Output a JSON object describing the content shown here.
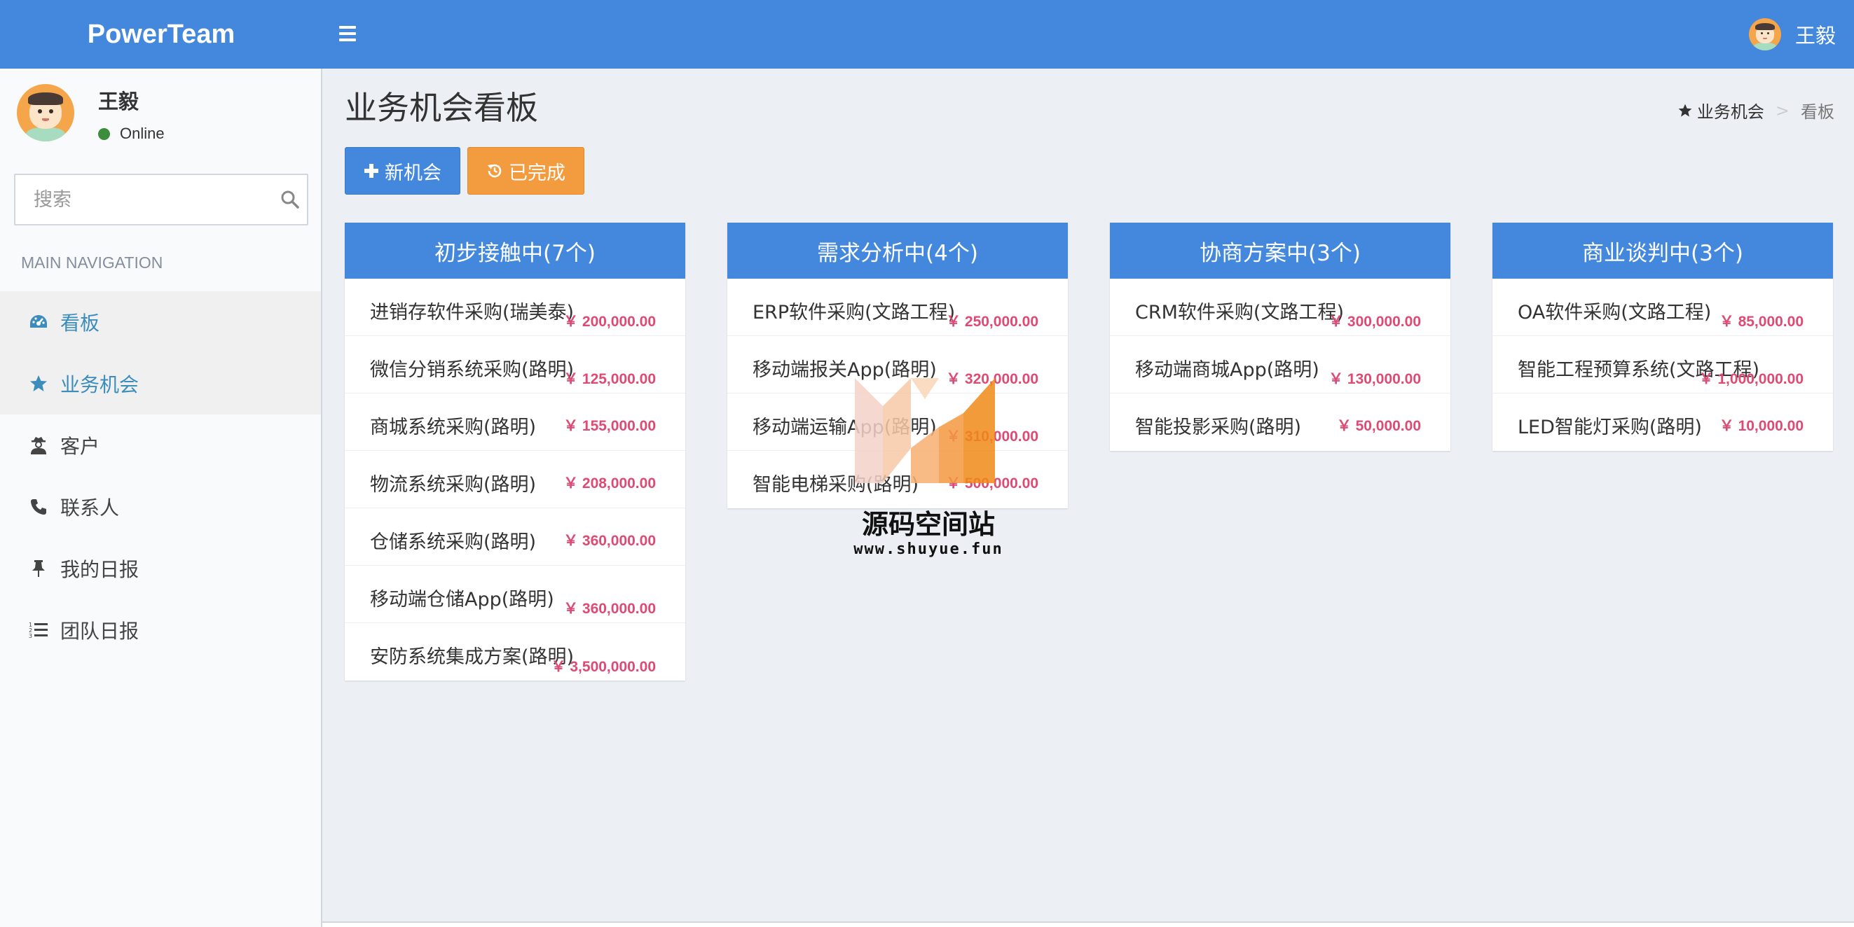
{
  "app": {
    "logo": "PowerTeam"
  },
  "header": {
    "user_name": "王毅"
  },
  "sidebar": {
    "user_name": "王毅",
    "status": "Online",
    "search_placeholder": "搜索",
    "nav_header": "MAIN NAVIGATION",
    "items": [
      {
        "label": "看板",
        "icon": "dashboard-icon"
      },
      {
        "label": "业务机会",
        "icon": "star-icon"
      },
      {
        "label": "客户",
        "icon": "user-secret-icon"
      },
      {
        "label": "联系人",
        "icon": "phone-icon"
      },
      {
        "label": "我的日报",
        "icon": "thumbtack-icon"
      },
      {
        "label": "团队日报",
        "icon": "list-icon"
      }
    ]
  },
  "page": {
    "title": "业务机会看板",
    "breadcrumb": {
      "parent": "业务机会",
      "current": "看板"
    },
    "buttons": {
      "new": "新机会",
      "done": "已完成"
    }
  },
  "columns": [
    {
      "title": "初步接触中(7个)",
      "cards": [
        {
          "title": "进销存软件采购(瑞美泰)",
          "amount": "￥ 200,000.00"
        },
        {
          "title": "微信分销系统采购(路明)",
          "amount": "￥ 125,000.00"
        },
        {
          "title": "商城系统采购(路明)",
          "amount": "￥ 155,000.00"
        },
        {
          "title": "物流系统采购(路明)",
          "amount": "￥ 208,000.00"
        },
        {
          "title": "仓储系统采购(路明)",
          "amount": "￥ 360,000.00"
        },
        {
          "title": "移动端仓储App(路明)",
          "amount": "￥ 360,000.00"
        },
        {
          "title": "安防系统集成方案(路明)",
          "amount": "￥ 3,500,000.00"
        }
      ]
    },
    {
      "title": "需求分析中(4个)",
      "cards": [
        {
          "title": "ERP软件采购(文路工程)",
          "amount": "￥ 250,000.00"
        },
        {
          "title": "移动端报关App(路明)",
          "amount": "￥ 320,000.00"
        },
        {
          "title": "移动端运输App(路明)",
          "amount": "￥ 310,000.00"
        },
        {
          "title": "智能电梯采购(路明)",
          "amount": "￥ 500,000.00"
        }
      ]
    },
    {
      "title": "协商方案中(3个)",
      "cards": [
        {
          "title": "CRM软件采购(文路工程)",
          "amount": "￥ 300,000.00"
        },
        {
          "title": "移动端商城App(路明)",
          "amount": "￥ 130,000.00"
        },
        {
          "title": "智能投影采购(路明)",
          "amount": "￥ 50,000.00"
        }
      ]
    },
    {
      "title": "商业谈判中(3个)",
      "cards": [
        {
          "title": "OA软件采购(文路工程)",
          "amount": "￥ 85,000.00"
        },
        {
          "title": "智能工程预算系统(文路工程)",
          "amount": "￥ 1,000,000.00"
        },
        {
          "title": "LED智能灯采购(路明)",
          "amount": "￥ 10,000.00"
        }
      ]
    }
  ],
  "watermark": {
    "name": "源码空间站",
    "url": "www.shuyue.fun"
  },
  "colors": {
    "primary": "#4388dc",
    "warning": "#f39c3f",
    "amount": "#dd4b75",
    "online": "#3c8d3c"
  }
}
